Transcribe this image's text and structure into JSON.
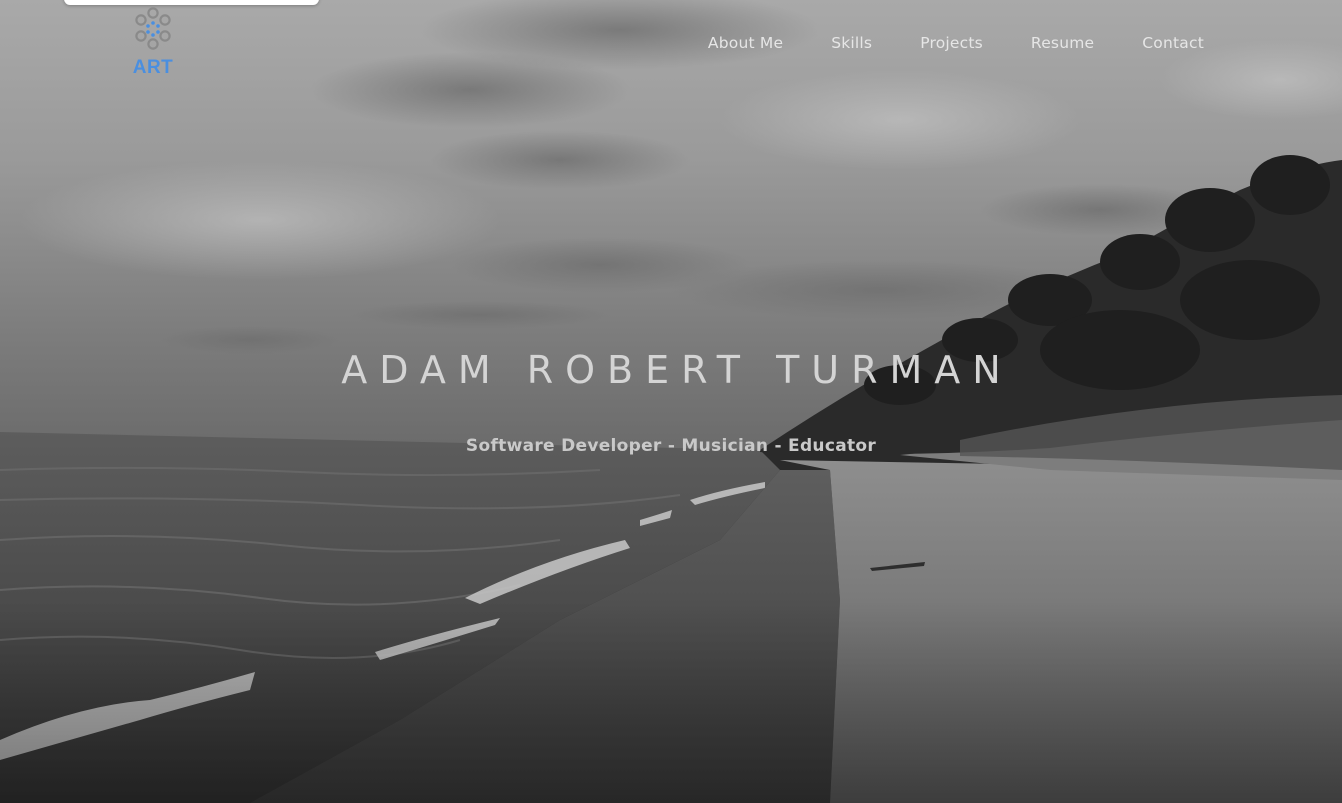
{
  "logo": {
    "text": "ART",
    "icon": "dot-circle-logo-icon",
    "color": "#4a8fe0"
  },
  "nav": {
    "items": [
      {
        "label": "About Me"
      },
      {
        "label": "Skills"
      },
      {
        "label": "Projects"
      },
      {
        "label": "Resume"
      },
      {
        "label": "Contact"
      }
    ]
  },
  "hero": {
    "title": "ADAM ROBERT TURMAN",
    "subtitle": "Software Developer - Musician - Educator",
    "background": "grayscale-beach-shoreline-photo"
  }
}
